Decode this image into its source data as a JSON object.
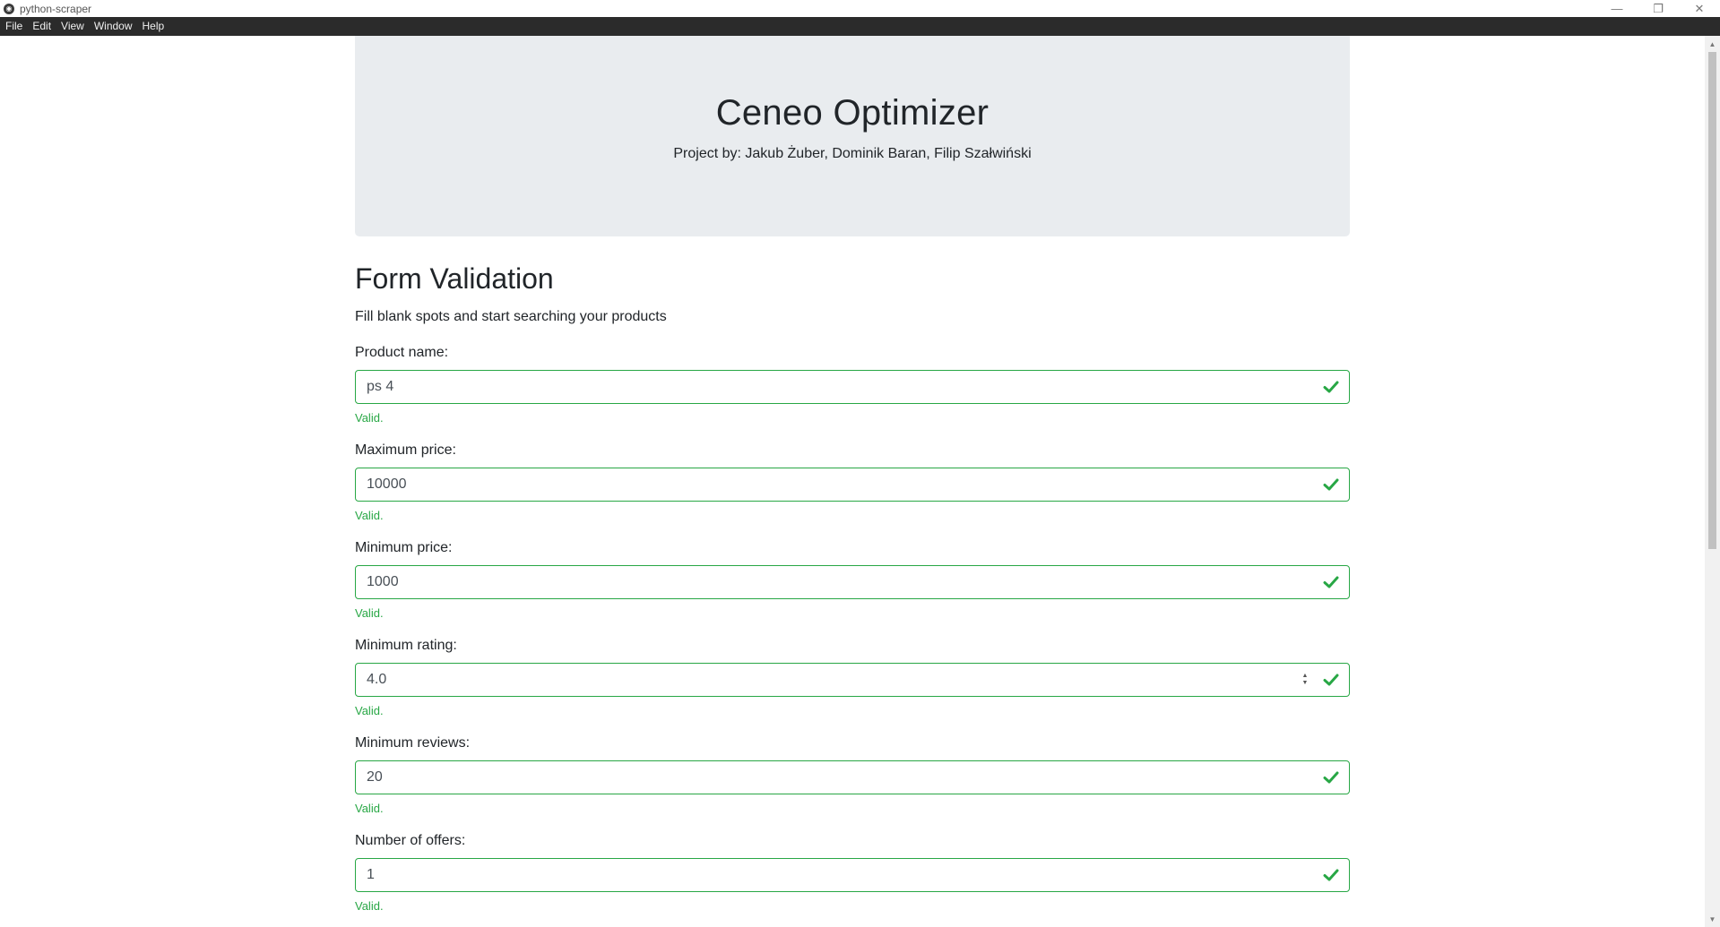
{
  "window": {
    "title": "python-scraper"
  },
  "menu": [
    "File",
    "Edit",
    "View",
    "Window",
    "Help"
  ],
  "header": {
    "title": "Ceneo Optimizer",
    "subtitle": "Project by: Jakub Żuber, Dominik Baran, Filip Szałwiński"
  },
  "form": {
    "title": "Form Validation",
    "lead": "Fill blank spots and start searching your products",
    "fields": [
      {
        "label": "Product name:",
        "value": "ps 4",
        "feedback": "Valid."
      },
      {
        "label": "Maximum price:",
        "value": "10000",
        "feedback": "Valid."
      },
      {
        "label": "Minimum price:",
        "value": "1000",
        "feedback": "Valid."
      },
      {
        "label": "Minimum rating:",
        "value": "4.0",
        "feedback": "Valid."
      },
      {
        "label": "Minimum reviews:",
        "value": "20",
        "feedback": "Valid."
      },
      {
        "label": "Number of offers:",
        "value": "1",
        "feedback": "Valid."
      }
    ]
  },
  "colors": {
    "valid": "#28a745",
    "jumbotron": "#e9ecef",
    "menubar": "#2b2b2b"
  }
}
